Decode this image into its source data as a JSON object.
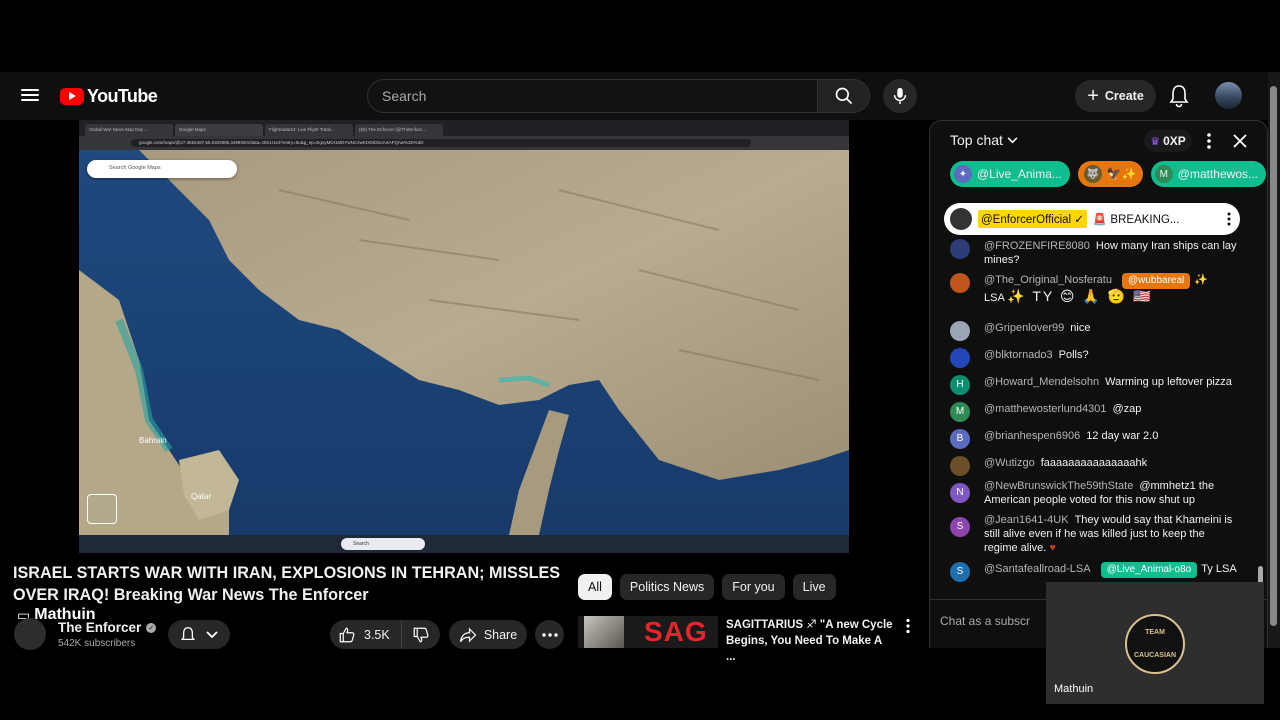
{
  "header": {
    "logo_text": "YouTube",
    "search_placeholder": "Search",
    "create_label": "Create"
  },
  "video": {
    "browser_tabs": [
      "Global War News Map Day ...",
      "Google Maps",
      "Flightradar24: Live Flight Track...",
      "(50) The Enforcer (@TheEnforc..."
    ],
    "url": "google.com/maps/@27.3652487,55.0303995,349940m/data=!3m1!1e3?entry=ttu&g_ep=EgoyMDI1MDYwNC4wKIXMDSoASAFQAw%3D%3D",
    "map_search_placeholder": "Search Google Maps",
    "map_place_label": "Bahrain",
    "map_place_label2": "Qatar",
    "taskbar_search": "Search"
  },
  "title": "ISRAEL STARTS WAR WITH IRAN, EXPLOSIONS IN TEHRAN; MISSLES OVER IRAQ! Breaking War News The Enforcer",
  "overlay_name": "Mathuin",
  "channel": {
    "name": "The Enforcer",
    "subscribers": "542K subscribers"
  },
  "actions": {
    "likes": "3.5K",
    "share": "Share"
  },
  "chips": [
    "All",
    "Politics News",
    "For you",
    "Live"
  ],
  "recommendation": {
    "thumb_text": "SAG",
    "title": "SAGITTARIUS ♐ \"A new Cycle Begins, You Need To Make A ..."
  },
  "chat": {
    "header": "Top chat",
    "xp": "0XP",
    "tickers": [
      "@Live_Anima...",
      "@matthewos..."
    ],
    "pinned": {
      "author": "@EnforcerOfficial ✓",
      "text": "🚨 BREAKING..."
    },
    "messages": [
      {
        "author": "@FROZENFIRE8080",
        "text": "How many Iran ships can lay mines?",
        "avatar_color": "#2c3e75",
        "avatar_letter": ""
      },
      {
        "author": "@The_Original_Nosferatu",
        "mention": "@wubbareal",
        "text": "LSA",
        "emojis": "✨ TY 😊 🙏 🫡 🇺🇸",
        "avatar_color": "#c0541d",
        "avatar_letter": ""
      },
      {
        "author": "@Gripenlover99",
        "text": "nice",
        "avatar_color": "#9aa5b5",
        "avatar_letter": ""
      },
      {
        "author": "@blktornado3",
        "text": "Polls?",
        "avatar_color": "#2345b8",
        "avatar_letter": ""
      },
      {
        "author": "@Howard_Mendelsohn",
        "text": "Warming up leftover pizza",
        "avatar_color": "#0b8f6e",
        "avatar_letter": "H"
      },
      {
        "author": "@matthewosterlund4301",
        "text": "@zap",
        "avatar_color": "#2e8b57",
        "avatar_letter": "M"
      },
      {
        "author": "@brianhespen6906",
        "text": "12 day war 2.0",
        "avatar_color": "#5c6bc0",
        "avatar_letter": "B"
      },
      {
        "author": "@Wutizgo",
        "text": "faaaaaaaaaaaaaaahk",
        "avatar_color": "#6b4f2a",
        "avatar_letter": ""
      },
      {
        "author": "@NewBrunswickThe59thState",
        "text": "@mmhetz1 the American people voted for this now shut up",
        "avatar_color": "#7e57c2",
        "avatar_letter": "N"
      },
      {
        "author": "@Jean1641-4UK",
        "text": "They would say that Khameini is still alive even if he was killed just to keep the regime alive.",
        "avatar_color": "#8e44ad",
        "avatar_letter": "S"
      },
      {
        "author": "@Santafeallroad-LSA",
        "mention": "@Live_Animal-o8o",
        "text": "Ty LSA",
        "avatar_color": "#1e6fb0",
        "avatar_letter": "S"
      }
    ],
    "input_placeholder": "Chat as a subscr"
  },
  "webcam": {
    "badge_top": "TEAM",
    "badge_bottom": "CAUCASIAN",
    "name": "Mathuin"
  }
}
